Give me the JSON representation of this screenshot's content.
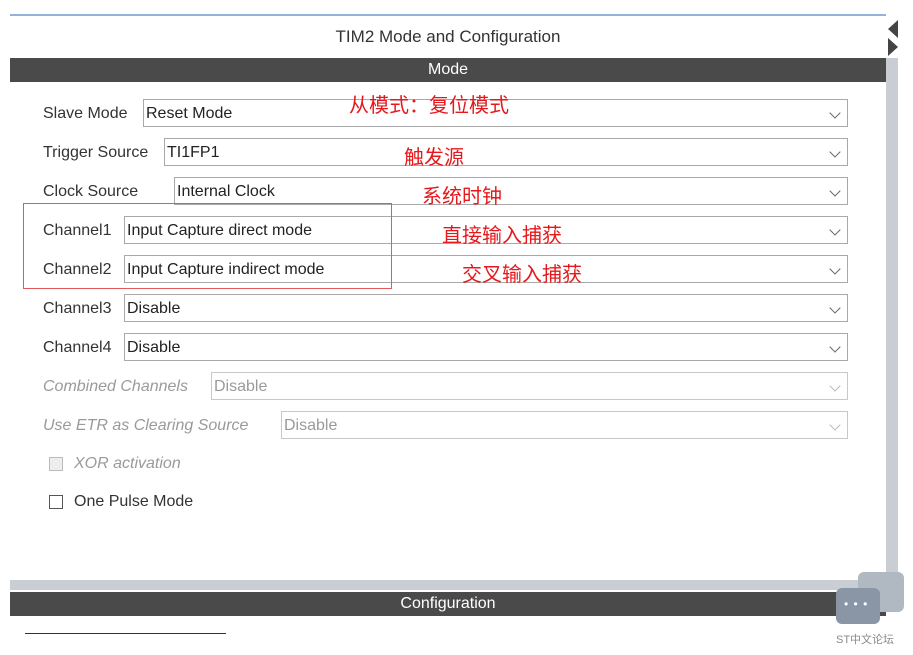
{
  "panel": {
    "title": "TIM2 Mode and Configuration",
    "mode_header": "Mode",
    "config_header": "Configuration"
  },
  "fields": {
    "slave_mode": {
      "label": "Slave Mode",
      "value": "Reset Mode"
    },
    "trigger_source": {
      "label": "Trigger Source",
      "value": "TI1FP1"
    },
    "clock_source": {
      "label": "Clock Source",
      "value": "Internal Clock"
    },
    "channel1": {
      "label": "Channel1",
      "value": "Input Capture direct mode"
    },
    "channel2": {
      "label": "Channel2",
      "value": "Input Capture indirect mode"
    },
    "channel3": {
      "label": "Channel3",
      "value": "Disable"
    },
    "channel4": {
      "label": "Channel4",
      "value": "Disable"
    },
    "combined_channels": {
      "label": "Combined Channels",
      "value": "Disable"
    },
    "use_etr": {
      "label": "Use ETR as Clearing Source",
      "value": "Disable"
    }
  },
  "checkboxes": {
    "xor": {
      "label": "XOR activation",
      "checked": false,
      "enabled": false
    },
    "one_pulse": {
      "label": "One Pulse Mode",
      "checked": false,
      "enabled": true
    }
  },
  "annotations": {
    "slave_mode": "从模式：复位模式",
    "trigger_source": "触发源",
    "clock_source": "系统时钟",
    "channel1": "直接输入捕获",
    "channel2": "交叉输入捕获"
  },
  "watermark": "ST中文论坛",
  "colors": {
    "section_bar": "#4a4a4a",
    "annotation": "#e5191c",
    "top_accent": "#8fb3d9"
  }
}
